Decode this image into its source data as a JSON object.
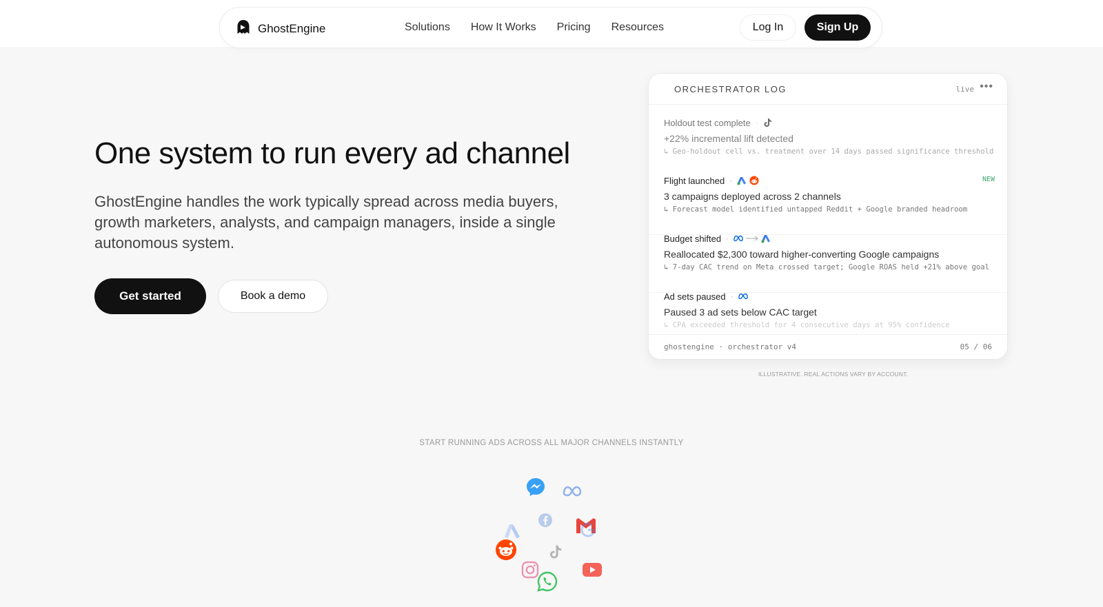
{
  "header": {
    "brand": "GhostEngine",
    "nav": [
      "Solutions",
      "How It Works",
      "Pricing",
      "Resources"
    ],
    "login_label": "Log In",
    "signup_label": "Sign Up"
  },
  "hero": {
    "title": "One system to run every ad channel",
    "subtitle": "GhostEngine handles the work typically spread across media buyers, growth marketers, analysts, and campaign managers, inside a single autonomous system.",
    "primary_cta": "Get started",
    "secondary_cta": "Book a demo"
  },
  "log": {
    "title": "ORCHESTRATOR LOG",
    "status": "live",
    "entries": [
      {
        "title": "Holdout test complete",
        "icons": [
          "tiktok-icon"
        ],
        "main": "+22% incremental lift detected",
        "detail": "↳ Geo-holdout cell vs. treatment over 14 days passed significance threshold"
      },
      {
        "title": "Flight launched",
        "icons": [
          "google-ads-icon",
          "reddit-icon"
        ],
        "badge": "NEW",
        "main": "3 campaigns deployed across 2 channels",
        "detail": "↳ Forecast model identified untapped Reddit + Google branded headroom"
      },
      {
        "title": "Budget shifted",
        "icons": [
          "meta-icon",
          "arrow-right-icon",
          "google-ads-icon"
        ],
        "main": "Reallocated $2,300 toward higher-converting Google campaigns",
        "detail": "↳ 7-day CAC trend on Meta crossed target; Google ROAS held +21% above goal"
      },
      {
        "title": "Ad sets paused",
        "icons": [
          "meta-icon"
        ],
        "main": "Paused 3 ad sets below CAC target",
        "detail": "↳ CPA exceeded threshold for 4 consecutive days at 95% confidence"
      }
    ],
    "footer_left": "ghostengine · orchestrator v4",
    "footer_right": "05 / 06"
  },
  "disclaimer": "ILLUSTRATIVE. REAL ACTIONS VARY BY ACCOUNT.",
  "channels": {
    "caption": "START RUNNING ADS ACROSS ALL MAJOR CHANNELS INSTANTLY",
    "icons": [
      "messenger-icon",
      "meta-icon",
      "facebook-icon",
      "google-ads-icon",
      "gmail-icon",
      "google-icon",
      "reddit-icon",
      "tiktok-icon",
      "instagram-icon",
      "youtube-icon",
      "whatsapp-icon"
    ]
  },
  "colors": {
    "accent": "#111111",
    "background": "#f7f7f7",
    "new_badge": "#3fa86d",
    "google_blue": "#4285f4",
    "reddit_orange": "#ff4500",
    "meta_blue": "#0668e1"
  }
}
